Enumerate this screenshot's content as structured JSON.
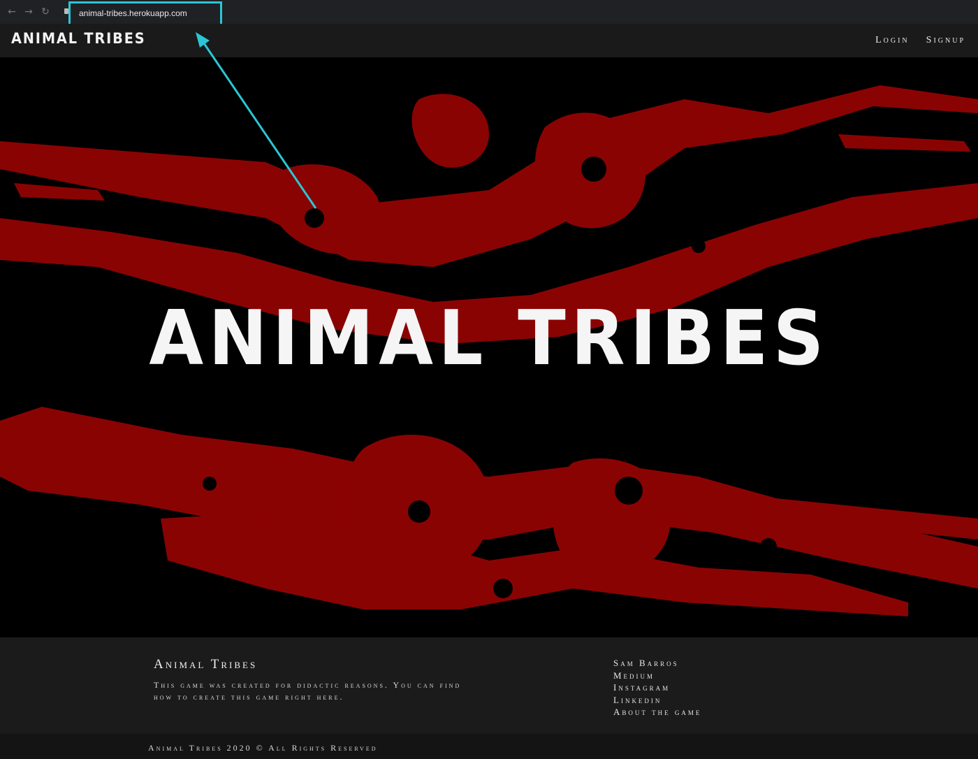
{
  "browser": {
    "url": "animal-tribes.herokuapp.com",
    "back_icon": "arrow-left-icon",
    "forward_icon": "arrow-right-icon",
    "reload_icon": "reload-icon",
    "highlight_color": "#2bc6d6"
  },
  "nav": {
    "brand": "ANIMAL TRIBES",
    "links": [
      "Login",
      "Signup"
    ]
  },
  "hero": {
    "title": "ANIMAL TRIBES",
    "splatter_color": "#8a0303"
  },
  "footer": {
    "title": "Animal Tribes",
    "description": "This game was created for didactic reasons. You can find how to create this game right here.",
    "links": [
      "Sam Barros",
      "Medium",
      "Instagram",
      "Linkedin",
      "About the game"
    ],
    "copyright": "Animal Tribes 2020 © All Rights Reserved"
  }
}
